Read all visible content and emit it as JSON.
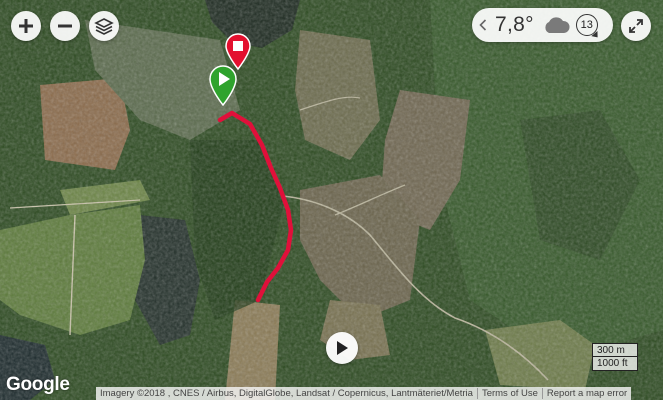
{
  "map": {
    "controls": {
      "zoom_in_icon": "plus-icon",
      "zoom_out_icon": "minus-icon",
      "layers_icon": "layers-icon",
      "fullscreen_icon": "expand-icon"
    },
    "weather": {
      "temperature": "7,8°",
      "condition_icon": "cloud-icon",
      "wind_speed": "13",
      "prev_icon": "chevron-left-icon"
    },
    "route": {
      "color": "#e0103a",
      "start_marker_color": "#2fa32d",
      "end_marker_color": "#e3102f"
    },
    "play_icon": "play-icon",
    "scale": {
      "metric": "300 m",
      "imperial": "1000 ft"
    },
    "provider_logo": "Google",
    "attribution": {
      "imagery": "Imagery ©2018 , CNES / Airbus, DigitalGlobe, Landsat / Copernicus, Lantmäteriet/Metria",
      "terms": "Terms of Use",
      "report": "Report a map error"
    }
  }
}
